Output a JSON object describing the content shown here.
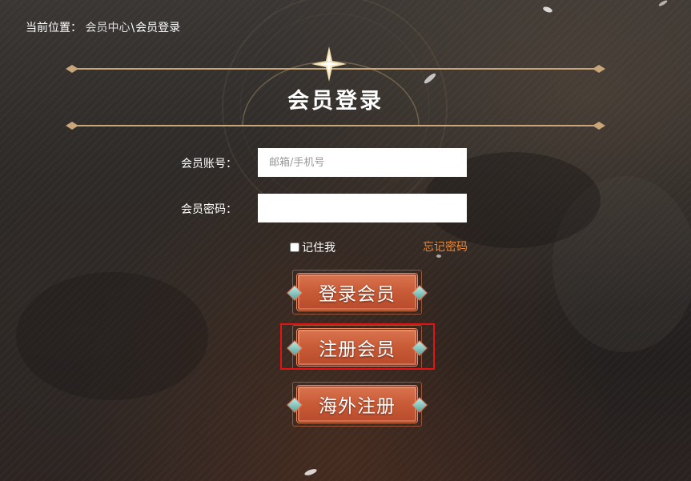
{
  "breadcrumb": {
    "prefix": "当前位置：",
    "items": [
      "会员中心",
      "会员登录"
    ],
    "separator": "\\"
  },
  "page_title": "会员登录",
  "form": {
    "account_label": "会员账号：",
    "account_placeholder": "邮箱/手机号",
    "account_value": "",
    "password_label": "会员密码：",
    "password_value": "",
    "remember_label": "记住我",
    "remember_checked": false,
    "forgot_label": "忘记密码"
  },
  "buttons": {
    "login": "登录会员",
    "register": "注册会员",
    "overseas": "海外注册"
  },
  "colors": {
    "accent_link": "#e98a3c",
    "button_fill": "#c85a36",
    "highlight_border": "#e41414"
  }
}
